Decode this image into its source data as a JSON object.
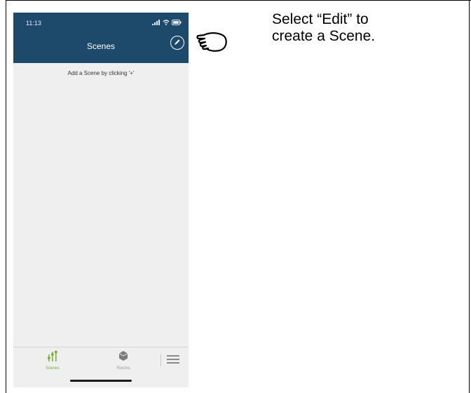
{
  "status_bar": {
    "time": "11:13"
  },
  "nav": {
    "title": "Scenes"
  },
  "main": {
    "empty_hint": "Add a Scene by clicking '+'"
  },
  "tabs": [
    {
      "label": "Scenes",
      "active": true
    },
    {
      "label": "Rooms",
      "active": false
    }
  ],
  "icons": {
    "edit": "pencil-circle-icon",
    "pointer": "pointing-hand-icon",
    "menu": "hamburger-menu-icon"
  },
  "instruction": {
    "text": "Select “Edit” to\ncreate a Scene."
  },
  "colors": {
    "header": "#1d4a6b",
    "accent": "#7bb33a",
    "background": "#efefef"
  }
}
